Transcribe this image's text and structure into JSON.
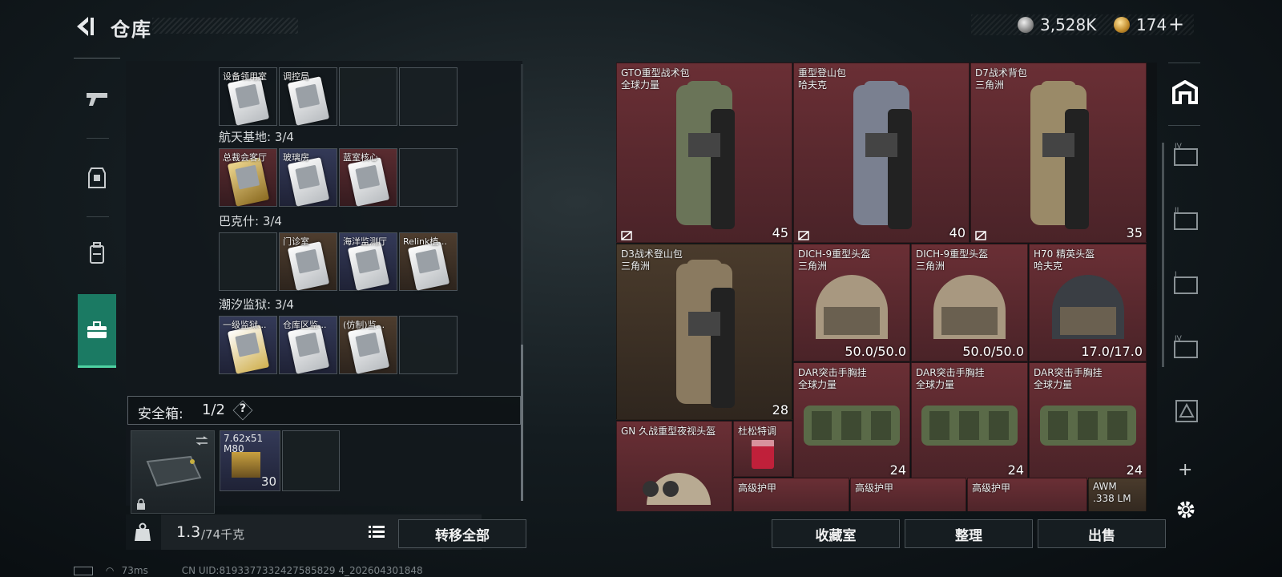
{
  "header": {
    "title": "仓库",
    "currency1": "3,528K",
    "currency2": "174",
    "plus": "+"
  },
  "left_panel": {
    "groups": [
      {
        "name": "",
        "cells": [
          {
            "label": "设备领用室",
            "color": "brown"
          },
          {
            "label": "调控局",
            "color": "brown"
          },
          {
            "label": "",
            "color": "empty"
          },
          {
            "label": "",
            "color": "empty"
          }
        ]
      },
      {
        "name": "航天基地: 3/4",
        "cells": [
          {
            "label": "总裁会客厅",
            "color": "red"
          },
          {
            "label": "玻璃房",
            "color": "blue"
          },
          {
            "label": "蓝室核心",
            "color": "red"
          },
          {
            "label": "",
            "color": "empty"
          }
        ]
      },
      {
        "name": "巴克什: 3/4",
        "cells": [
          {
            "label": "",
            "color": "empty"
          },
          {
            "label": "门诊室",
            "color": "brown"
          },
          {
            "label": "海洋监测厅",
            "color": "blue"
          },
          {
            "label": "Relink植...",
            "color": "brown"
          }
        ]
      },
      {
        "name": "潮汐监狱: 3/4",
        "cells": [
          {
            "label": "一级监狱...",
            "color": "blue"
          },
          {
            "label": "仓库区监...",
            "color": "blue"
          },
          {
            "label": "(仿制)监...",
            "color": "brown"
          },
          {
            "label": "",
            "color": "empty"
          }
        ]
      }
    ],
    "safebox": {
      "label": "安全箱:",
      "count": "1/2",
      "help": "?"
    },
    "safe_slot": {
      "ammo_name": "7.62x51",
      "ammo_sub": "M80",
      "ammo_count": "30"
    },
    "weight": {
      "current": "1.3",
      "max": "/74千克"
    },
    "transfer_all": "转移全部"
  },
  "grid": {
    "items": [
      {
        "name": "GTO重型战术包",
        "sub": "全球力量",
        "value": "45",
        "kind": "bag",
        "color": "red"
      },
      {
        "name": "重型登山包",
        "sub": "哈夫克",
        "value": "40",
        "kind": "bag",
        "color": "red"
      },
      {
        "name": "D7战术背包",
        "sub": "三角洲",
        "value": "35",
        "kind": "bag",
        "color": "red"
      },
      {
        "name": "D3战术登山包",
        "sub": "三角洲",
        "value": "28",
        "kind": "bag",
        "color": "brown"
      },
      {
        "name": "DICH-9重型头盔",
        "sub": "三角洲",
        "value": "50.0/50.0",
        "kind": "helmet",
        "color": "red"
      },
      {
        "name": "DICH-9重型头盔",
        "sub": "三角洲",
        "value": "50.0/50.0",
        "kind": "helmet",
        "color": "red"
      },
      {
        "name": "H70 精英头盔",
        "sub": "哈夫克",
        "value": "17.0/17.0",
        "kind": "helmet",
        "color": "red"
      },
      {
        "name": "DAR突击手胸挂",
        "sub": "全球力量",
        "value": "24",
        "kind": "vest",
        "color": "red"
      },
      {
        "name": "DAR突击手胸挂",
        "sub": "全球力量",
        "value": "24",
        "kind": "vest",
        "color": "red"
      },
      {
        "name": "DAR突击手胸挂",
        "sub": "全球力量",
        "value": "24",
        "kind": "vest",
        "color": "red"
      },
      {
        "name": "GN 久战重型夜视头盔",
        "sub": "",
        "value": "",
        "kind": "nvhelmet",
        "color": "red"
      },
      {
        "name": "杜松特调",
        "sub": "",
        "value": "",
        "kind": "drink",
        "color": "red"
      },
      {
        "name": "高级护甲",
        "sub": "",
        "value": "",
        "kind": "none",
        "color": "red"
      },
      {
        "name": "高级护甲",
        "sub": "",
        "value": "",
        "kind": "none",
        "color": "red"
      },
      {
        "name": "高级护甲",
        "sub": "",
        "value": "",
        "kind": "none",
        "color": "red"
      },
      {
        "name": "AWM",
        "sub": ".338 LM",
        "value": "",
        "kind": "none",
        "color": "brown"
      }
    ]
  },
  "bottom_buttons": {
    "collection": "收藏室",
    "sort": "整理",
    "sell": "出售"
  },
  "status": {
    "ping": "73ms",
    "uid": "CN UID:8193377332427585829 4_202604301848"
  },
  "colors": {
    "accent": "#1b7a63",
    "red_cell": "#5a2c30",
    "brown_cell": "#4a3b2c"
  }
}
